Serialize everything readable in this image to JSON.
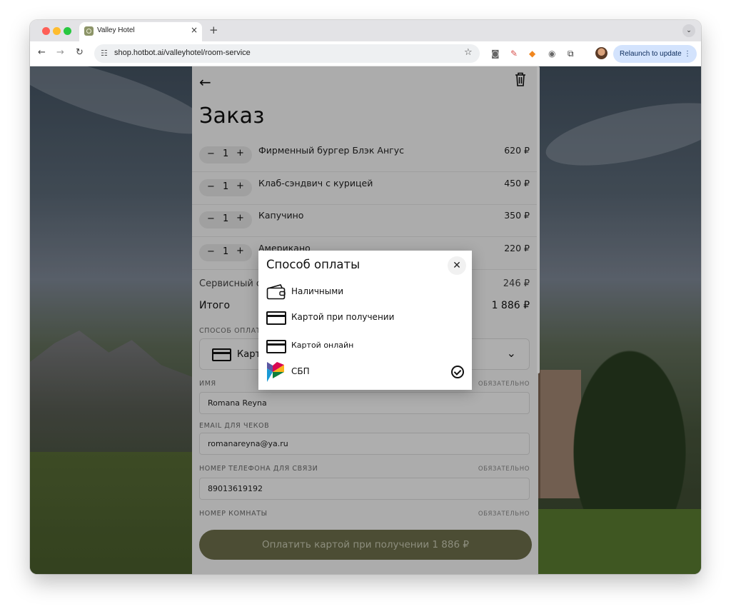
{
  "browser": {
    "tab_title": "Valley Hotel",
    "tab_close": "×",
    "new_tab": "+",
    "url": "shop.hotbot.ai/valleyhotel/room-service",
    "relaunch_label": "Relaunch to update",
    "relaunch_dots": "⋮",
    "tab_menu": "⌄",
    "icons": {
      "back": "←",
      "forward": "→",
      "reload": "↻",
      "site_info": "☷",
      "bookmark": "☆",
      "camera": "◙",
      "pen": "✎",
      "ext1": "◆",
      "ext2": "◉",
      "puzzle": "⧉"
    }
  },
  "order": {
    "back_icon": "←",
    "title": "Заказ",
    "items": [
      {
        "qty": "1",
        "name": "Фирменный бургер Блэк Ангус",
        "price": "620 ₽"
      },
      {
        "qty": "1",
        "name": "Клаб-сэндвич с курицей",
        "price": "450 ₽"
      },
      {
        "qty": "1",
        "name": "Капучино",
        "price": "350 ₽"
      },
      {
        "qty": "1",
        "name": "Американо",
        "price": "220 ₽"
      }
    ],
    "stepper_minus": "−",
    "stepper_plus": "+",
    "service_label": "Сервисный с",
    "service_value": "246 ₽",
    "total_label": "Итого",
    "total_value": "1 886 ₽",
    "payment_label": "СПОСОБ ОПЛАТ",
    "payment_selected": "Карт",
    "payment_chevron": "⌄",
    "required": "ОБЯЗАТЕЛЬНО",
    "name_label": "ИМЯ",
    "name_value": "Romana Reyna",
    "email_label": "EMAIL ДЛЯ ЧЕКОВ",
    "email_value": "romanareyna@ya.ru",
    "phone_label": "НОМЕР ТЕЛЕФОНА ДЛЯ СВЯЗИ",
    "phone_value": "89013619192",
    "room_label": "НОМЕР КОМНАТЫ",
    "pay_button": "Оплатить картой при получении 1 886 ₽"
  },
  "modal": {
    "title": "Способ оплаты",
    "close_icon": "✕",
    "options": [
      {
        "label": "Наличными"
      },
      {
        "label": "Картой при получении"
      },
      {
        "label": "Картой онлайн"
      },
      {
        "label": "СБП",
        "selected": true
      }
    ]
  },
  "colors": {
    "pay_button": "#6e6f4b",
    "relaunch": "#d3e3fd",
    "sbp_colors": [
      "#5b57a2",
      "#d90751",
      "#fab41c",
      "#0f7f3d",
      "#1a9ad6"
    ]
  }
}
